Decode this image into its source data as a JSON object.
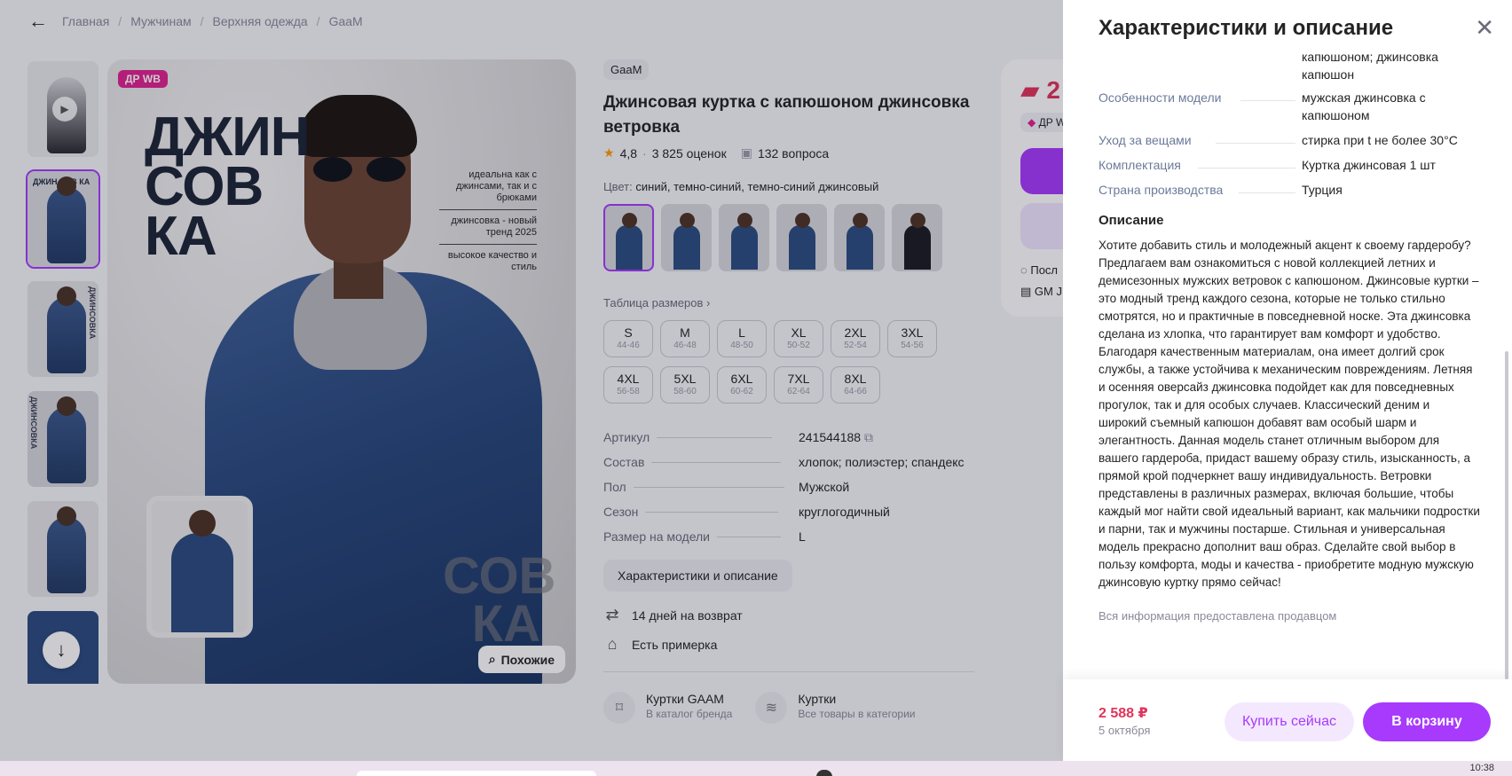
{
  "breadcrumbs": [
    "Главная",
    "Мужчинам",
    "Верхняя одежда",
    "GaaM"
  ],
  "hero": {
    "badge": "ДР WB",
    "big_word": "ДЖИН СОВ КА",
    "notes": [
      "идеальна как с джинсами, так и с брюками",
      "джинсовка - новый тренд 2025",
      "высокое качество и стиль"
    ],
    "ghost_word": "СОВ КА",
    "similar_label": "Похожие"
  },
  "thumb_labels": [
    "ДЖИН СОВ КА",
    "ДЖИНСОВКА",
    "ДЖИНСОВКА"
  ],
  "product": {
    "brand": "GaaM",
    "title": "Джинсовая куртка с капюшоном джинсовка ветровка",
    "rating": "4,8",
    "reviews": "3 825 оценок",
    "questions": "132 вопроса",
    "color_label": "Цвет:",
    "color_value": "синий, темно-синий, темно-синий джинсовый",
    "size_table_link": "Таблица размеров",
    "sizes": [
      {
        "s": "S",
        "r": "44-46"
      },
      {
        "s": "M",
        "r": "46-48"
      },
      {
        "s": "L",
        "r": "48-50"
      },
      {
        "s": "XL",
        "r": "50-52"
      },
      {
        "s": "2XL",
        "r": "52-54"
      },
      {
        "s": "3XL",
        "r": "54-56"
      },
      {
        "s": "4XL",
        "r": "56-58"
      },
      {
        "s": "5XL",
        "r": "58-60"
      },
      {
        "s": "6XL",
        "r": "60-62"
      },
      {
        "s": "7XL",
        "r": "62-64"
      },
      {
        "s": "8XL",
        "r": "64-66"
      }
    ],
    "specs": [
      {
        "k": "Артикул",
        "v": "241544188"
      },
      {
        "k": "Состав",
        "v": "хлопок; полиэстер; спандекс"
      },
      {
        "k": "Пол",
        "v": "Мужской"
      },
      {
        "k": "Сезон",
        "v": "круглогодичный"
      },
      {
        "k": "Размер на модели",
        "v": "L"
      }
    ],
    "char_button": "Характеристики и описание",
    "perks": [
      "14 дней на возврат",
      "Есть примерка"
    ],
    "categories": [
      {
        "title": "Куртки GAAM",
        "sub": "В каталог бренда"
      },
      {
        "title": "Куртки",
        "sub": "Все товары в категории"
      }
    ]
  },
  "buybox": {
    "price_partial": "2",
    "tag_partial": "ДР W",
    "line1_partial": "Посл",
    "line2_partial": "GM J"
  },
  "drawer": {
    "title": "Характеристики и описание",
    "rows": [
      {
        "k": "",
        "v": "капюшоном; джинсовка капюшон"
      },
      {
        "k": "Особенности модели",
        "v": "мужская джинсовка с капюшоном"
      },
      {
        "k": "Уход за вещами",
        "v": "стирка при t не более 30°C"
      },
      {
        "k": "Комплектация",
        "v": "Куртка джинсовая 1 шт"
      },
      {
        "k": "Страна производства",
        "v": "Турция"
      }
    ],
    "desc_title": "Описание",
    "description": "Хотите добавить стиль и молодежный акцент к своему гардеробу? Предлагаем вам ознакомиться с новой коллекцией летних и демисезонных мужских ветровок с капюшоном. Джинсовые куртки – это модный тренд каждого сезона, которые не только стильно смотрятся, но и практичные в повседневной носке. Эта джинсовка сделана из хлопка, что гарантирует вам комфорт и удобство. Благодаря качественным материалам, она имеет долгий срок службы, а также устойчива к механическим повреждениям. Летняя и осенняя оверсайз джинсовка подойдет как для повседневных прогулок, так и для особых случаев. Классический деним и широкий съемный капюшон добавят вам особый шарм и элегантность. Данная модель станет отличным выбором для вашего гардероба, придаст вашему образу стиль, изысканность, а прямой крой подчеркнет вашу индивидуальность. Ветровки представлены в различных размерах, включая большие, чтобы каждый мог найти свой идеальный вариант, как мальчики подростки и парни, так и мужчины постарше. Стильная и универсальная модель прекрасно дополнит ваш образ. Сделайте свой выбор в пользу комфорта, моды и качества - приобретите модную мужскую джинсовую куртку прямо сейчас!",
    "seller_note": "Вся информация предоставлена продавцом",
    "price": "2 588 ₽",
    "delivery": "5 октября",
    "buy_now": "Купить сейчас",
    "add_to_cart": "В корзину"
  },
  "taskbar": {
    "clock_partial": "10:38"
  },
  "colors": {
    "accent": "#a73afd",
    "price": "#e0345b",
    "badge": "#e0228f"
  }
}
